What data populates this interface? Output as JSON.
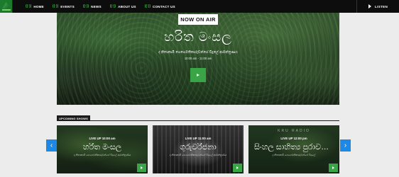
{
  "nav": {
    "items": [
      {
        "icon": "((·))",
        "label": "HOME",
        "active": true
      },
      {
        "icon": "((·))",
        "label": "EVENTS"
      },
      {
        "icon": "((·))",
        "label": "NEWS"
      },
      {
        "icon": "((·))",
        "label": "ABOUT US"
      },
      {
        "icon": "((·))",
        "label": "CONTACT US"
      }
    ],
    "listen_label": "LISTEN"
  },
  "hero": {
    "badge": "NOW ON AIR",
    "title": "හරිත මංසල",
    "subtitle": "ද නිතාකාමී ගෙගෙමතිකාරුවන්ගේ විදුලේ ආමන්ත්‍රණය",
    "time": "10:00 am - 11:00 am"
  },
  "upcoming": {
    "heading": "UPCOMING SHOWS",
    "cards": [
      {
        "time": "LIVE UP 10:00 am",
        "title": "හරිත මංසල",
        "desc": "ද නිතාකාමී ගෙගෙමතිකාරුවන්ගේ විදුලේ ආමන්ත්‍රණය"
      },
      {
        "time": "LIVE UP 11:00 am",
        "title": "ගුරුවරිජනා",
        "desc": "ද නිතාකාමී ගෙගෙමතිකාරුවන්ගේ විදුලේ ආමන්ත්‍රණය"
      },
      {
        "time": "LIVE UP 12:00 pm",
        "title": "සිංහල සාහිත්‍ය පුරාවත්ත...",
        "desc": "ද නිතාකාමී ගෙගෙමතිකාරුවන්ගේ විදුලේ",
        "watermark": "KRU RADIO"
      }
    ]
  },
  "colors": {
    "accent": "#3aa547",
    "arrow": "#1e88e5",
    "nav_bg": "#0d0d0d"
  }
}
